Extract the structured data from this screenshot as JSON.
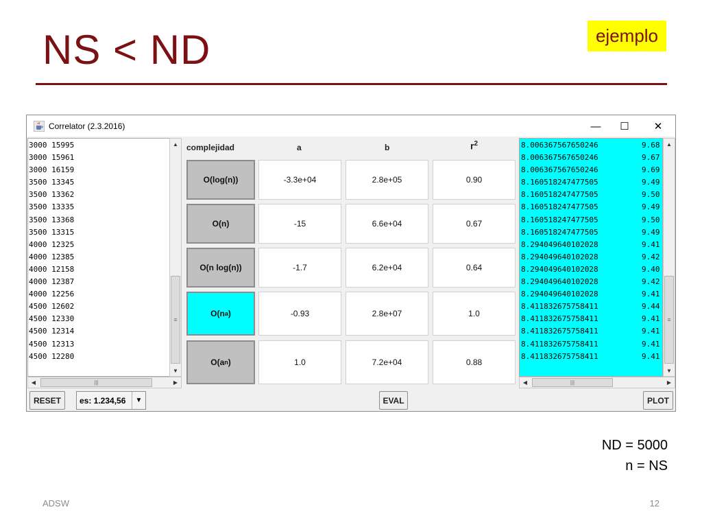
{
  "slide": {
    "title": "NS < ND",
    "tag": "ejemplo",
    "notes": [
      "ND = 5000",
      "n = NS"
    ],
    "footer_left": "ADSW",
    "page_number": "12"
  },
  "window": {
    "title": "Correlator (2.3.2016)",
    "controls": {
      "minimize": "—",
      "maximize": "☐",
      "close": "✕"
    }
  },
  "left_list": [
    "3000 15995",
    "3000 15961",
    "3000 16159",
    "3500 13345",
    "3500 13362",
    "3500 13335",
    "3500 13368",
    "3500 13315",
    "4000 12325",
    "4000 12385",
    "4000 12158",
    "4000 12387",
    "4000 12256",
    "4500 12602",
    "4500 12330",
    "4500 12314",
    "4500 12313",
    "4500 12280"
  ],
  "table": {
    "headers": {
      "complejidad": "complejidad",
      "a": "a",
      "b": "b",
      "r2": "r",
      "r2_sup": "2"
    },
    "rows": [
      {
        "label": "O(log(n))",
        "sup": "",
        "a": "-3.3e+04",
        "b": "2.8e+05",
        "r2": "0.90"
      },
      {
        "label": "O(n)",
        "sup": "",
        "a": "-15",
        "b": "6.6e+04",
        "r2": "0.67"
      },
      {
        "label": "O(n log(n))",
        "sup": "",
        "a": "-1.7",
        "b": "6.2e+04",
        "r2": "0.64"
      },
      {
        "label": "O(n",
        "sup": "a",
        "a": "-0.93",
        "b": "2.8e+07",
        "r2": "1.0"
      },
      {
        "label": "O(a",
        "sup": "n",
        "a": "1.0",
        "b": "7.2e+04",
        "r2": "0.88"
      }
    ]
  },
  "right_list": [
    [
      "8.006367567650246",
      "9.68"
    ],
    [
      "8.006367567650246",
      "9.67"
    ],
    [
      "8.006367567650246",
      "9.69"
    ],
    [
      "8.160518247477505",
      "9.49"
    ],
    [
      "8.160518247477505",
      "9.50"
    ],
    [
      "8.160518247477505",
      "9.49"
    ],
    [
      "8.160518247477505",
      "9.50"
    ],
    [
      "8.160518247477505",
      "9.49"
    ],
    [
      "8.294049640102028",
      "9.41"
    ],
    [
      "8.294049640102028",
      "9.42"
    ],
    [
      "8.294049640102028",
      "9.40"
    ],
    [
      "8.294049640102028",
      "9.42"
    ],
    [
      "8.294049640102028",
      "9.41"
    ],
    [
      "8.411832675758411",
      "9.44"
    ],
    [
      "8.411832675758411",
      "9.41"
    ],
    [
      "8.411832675758411",
      "9.41"
    ],
    [
      "8.411832675758411",
      "9.41"
    ],
    [
      "8.411832675758411",
      "9.41"
    ]
  ],
  "buttons": {
    "reset": "RESET",
    "format_value": "es: 1.234,56",
    "eval": "EVAL",
    "plot": "PLOT"
  },
  "colors": {
    "title": "#7b1113",
    "tag_bg": "#ffff00",
    "selected": "#00ffff"
  },
  "icons": {
    "app": "java-cup-icon",
    "dropdown": "chevron-down-icon"
  }
}
